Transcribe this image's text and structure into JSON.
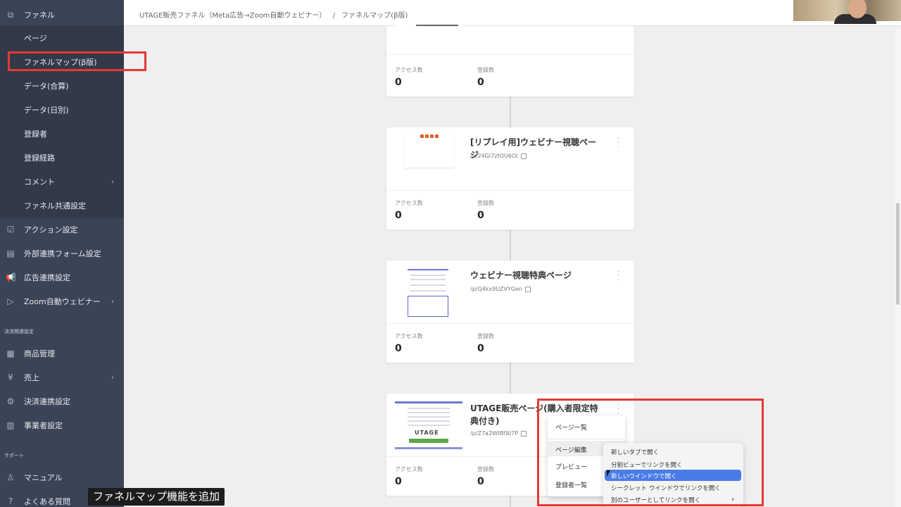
{
  "sidebar": {
    "funnel": "ファネル",
    "sub_items": [
      "ページ",
      "ファネルマップ(β版)",
      "データ(合算)",
      "データ(日別)",
      "登録者",
      "登録経路",
      "コメント",
      "ファネル共通設定"
    ],
    "main_items": [
      "アクション設定",
      "外部連携フォーム設定",
      "広告連携設定",
      "Zoom自動ウェビナー"
    ],
    "payment_section": "決済関連設定",
    "payment_items": [
      "商品管理",
      "売上",
      "決済連携設定",
      "事業者設定"
    ],
    "support_section": "サポート",
    "support_items": [
      "マニュアル",
      "よくある質問"
    ]
  },
  "breadcrumb": {
    "funnel": "UTAGE販売ファネル（Meta広告→Zoom自動ウェビナー）",
    "separator": "/",
    "current": "ファネルマップ(β版)"
  },
  "cards": [
    {
      "title": "",
      "slug": "",
      "stats": {
        "access_label": "アクセス数",
        "access_value": "0",
        "register_label": "登録数",
        "register_value": "0"
      }
    },
    {
      "title": "[リプレイ用]ウェビナー視聴ページ",
      "slug": "/p/24GI7ztOU6OI",
      "stats": {
        "access_label": "アクセス数",
        "access_value": "0",
        "register_label": "登録数",
        "register_value": "0"
      }
    },
    {
      "title": "ウェビナー視聴特典ページ",
      "slug": "/p/Q4kx9UZVYGen",
      "stats": {
        "access_label": "アクセス数",
        "access_value": "0",
        "register_label": "登録数",
        "register_value": "0"
      }
    },
    {
      "title": "UTAGE販売ページ(購入者限定特典付き)",
      "slug": "/p/Z7a2WtBfAI7P",
      "thumb_brand": "UTAGE",
      "stats": {
        "access_label": "アクセス数",
        "access_value": "0",
        "register_label": "登録数",
        "register_value": "0"
      }
    }
  ],
  "page_menu": [
    "ページ一覧",
    "ページ編集",
    "プレビュー",
    "登録者一覧"
  ],
  "link_menu": [
    "新しいタブで開く",
    "分割ビューでリンクを開く",
    "新しいウインドウで開く",
    "シークレット ウインドウでリンクを開く",
    "別のユーザーとしてリンクを開く"
  ],
  "caption": "ファネルマップ機能を追加",
  "colors": {
    "sidebar": "#3b4456",
    "highlight": "#e53935",
    "menu_selected": "#4a7ce8"
  }
}
